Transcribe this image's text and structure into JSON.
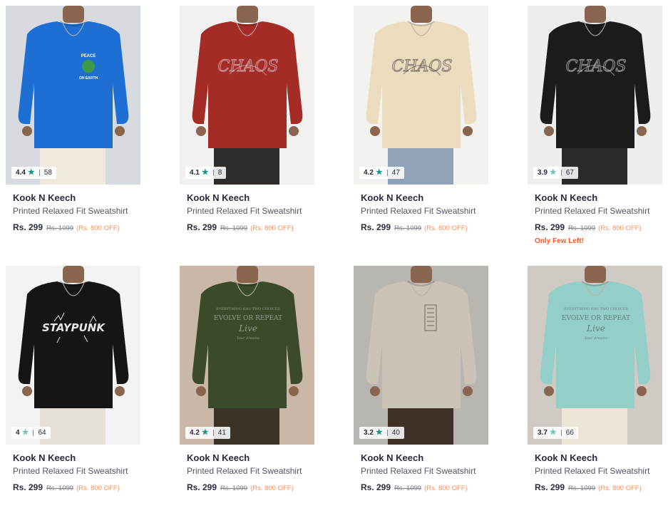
{
  "products": [
    {
      "rating": "4.4",
      "count": "58",
      "brand": "Kook N Keech",
      "name": "Printed Relaxed Fit Sweatshirt",
      "price": "Rs. 299",
      "mrp": "Rs. 1099",
      "discount": "(Rs. 800 OFF)",
      "note": "",
      "shirt_color": "#1d6fd4",
      "bg_color": "#d7dade",
      "pants_color": "#efe9de",
      "star_color": "#14958f",
      "graphic": "PEACE ON EARTH"
    },
    {
      "rating": "4.1",
      "count": "8",
      "brand": "Kook N Keech",
      "name": "Printed Relaxed Fit Sweatshirt",
      "price": "Rs. 299",
      "mrp": "Rs. 1099",
      "discount": "(Rs. 800 OFF)",
      "note": "",
      "shirt_color": "#a52b26",
      "bg_color": "#f2f1ef",
      "pants_color": "#2e2b29",
      "star_color": "#14958f",
      "graphic": "CHAOS"
    },
    {
      "rating": "4.2",
      "count": "47",
      "brand": "Kook N Keech",
      "name": "Printed Relaxed Fit Sweatshirt",
      "price": "Rs. 299",
      "mrp": "Rs. 1099",
      "discount": "(Rs. 800 OFF)",
      "note": "",
      "shirt_color": "#ecdcbe",
      "bg_color": "#f4f2ee",
      "pants_color": "#8fa2b8",
      "star_color": "#14958f",
      "graphic": "CHAOS"
    },
    {
      "rating": "3.9",
      "count": "67",
      "brand": "Kook N Keech",
      "name": "Printed Relaxed Fit Sweatshirt",
      "price": "Rs. 299",
      "mrp": "Rs. 1099",
      "discount": "(Rs. 800 OFF)",
      "note": "Only Few Left!",
      "shirt_color": "#1b1b1b",
      "bg_color": "#eeeeec",
      "pants_color": "#2a2a2a",
      "star_color": "#72c2bb",
      "graphic": "CHAOS"
    },
    {
      "rating": "4",
      "count": "64",
      "brand": "Kook N Keech",
      "name": "Printed Relaxed Fit Sweatshirt",
      "price": "Rs. 299",
      "mrp": "Rs. 1099",
      "discount": "(Rs. 800 OFF)",
      "note": "",
      "shirt_color": "#151515",
      "bg_color": "#f3f3f3",
      "pants_color": "#e6e1d8",
      "star_color": "#72c2bb",
      "graphic": "STAY PUNK"
    },
    {
      "rating": "4.2",
      "count": "41",
      "brand": "Kook N Keech",
      "name": "Printed Relaxed Fit Sweatshirt",
      "price": "Rs. 299",
      "mrp": "Rs. 1099",
      "discount": "(Rs. 800 OFF)",
      "note": "",
      "shirt_color": "#3b4a2a",
      "bg_color": "#c9b7a8",
      "pants_color": "#3c3127",
      "star_color": "#14958f",
      "graphic": "EVOLVE OR REPEAT"
    },
    {
      "rating": "3.2",
      "count": "40",
      "brand": "Kook N Keech",
      "name": "Printed Relaxed Fit Sweatshirt",
      "price": "Rs. 299",
      "mrp": "Rs. 1099",
      "discount": "(Rs. 800 OFF)",
      "note": "",
      "shirt_color": "#cbc3b8",
      "bg_color": "#b9b6b2",
      "pants_color": "#3f3127",
      "star_color": "#14958f",
      "graphic": "BADGE"
    },
    {
      "rating": "3.7",
      "count": "66",
      "brand": "Kook N Keech",
      "name": "Printed Relaxed Fit Sweatshirt",
      "price": "Rs. 299",
      "mrp": "Rs. 1099",
      "discount": "(Rs. 800 OFF)",
      "note": "",
      "shirt_color": "#93cfc8",
      "bg_color": "#cfcac4",
      "pants_color": "#ece6da",
      "star_color": "#72c2bb",
      "graphic": "EVOLVE OR REPEAT"
    }
  ]
}
